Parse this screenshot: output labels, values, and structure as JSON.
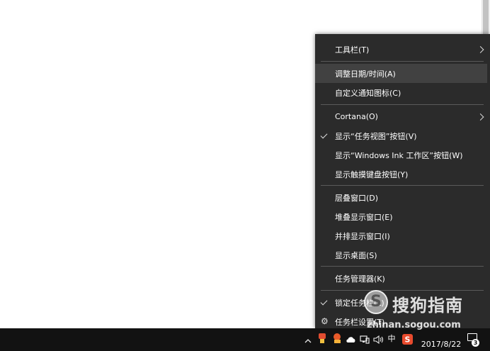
{
  "menu": {
    "items": [
      {
        "label": "工具栏(T)",
        "submenu": true
      },
      {
        "label": "调整日期/时间(A)",
        "hover": true
      },
      {
        "label": "自定义通知图标(C)"
      },
      {
        "label": "Cortana(O)",
        "submenu": true
      },
      {
        "label": "显示“任务视图”按钮(V)",
        "checked": true
      },
      {
        "label": "显示“Windows Ink 工作区”按钮(W)"
      },
      {
        "label": "显示触摸键盘按钮(Y)"
      },
      {
        "label": "层叠窗口(D)"
      },
      {
        "label": "堆叠显示窗口(E)"
      },
      {
        "label": "并排显示窗口(I)"
      },
      {
        "label": "显示桌面(S)"
      },
      {
        "label": "任务管理器(K)"
      },
      {
        "label": "锁定任务栏(L)",
        "checked": true
      },
      {
        "label": "任务栏设置(T)",
        "icon": "gear-icon"
      }
    ]
  },
  "taskbar": {
    "ime_label": "中",
    "clock_time": "",
    "clock_date": "2017/8/22",
    "notification_count": "3",
    "tray_icons": [
      "chevron-up-icon",
      "app-tray-icon",
      "app-tray-icon-2",
      "cloud-icon",
      "network-icon",
      "volume-icon",
      "ime-indicator",
      "sogou-icon"
    ]
  },
  "watermark": {
    "brand": "搜狗指南",
    "url": "zhinan.sogou.com"
  },
  "colors": {
    "menu_bg": "#2b2b2b",
    "menu_hover": "#414141",
    "taskbar_bg": "#121212",
    "desktop_bg": "#ffffff"
  }
}
